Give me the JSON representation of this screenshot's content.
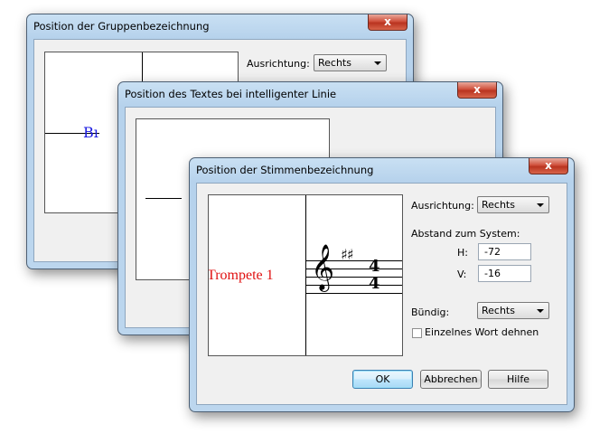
{
  "dialog_back": {
    "title": "Position der Gruppenbezeichnung",
    "close_label": "x",
    "orientation_label": "Ausrichtung:",
    "orientation_value": "Rechts",
    "preview_text": "Bı"
  },
  "dialog_middle": {
    "title": "Position des Textes bei intelligenter Linie",
    "close_label": "x"
  },
  "dialog_front": {
    "title": "Position der Stimmenbezeichnung",
    "close_label": "x",
    "preview_text": "Trompete 1",
    "orientation_label": "Ausrichtung:",
    "orientation_value": "Rechts",
    "distance_label": "Abstand zum System:",
    "h_label": "H:",
    "h_value": "-72",
    "v_label": "V:",
    "v_value": "-16",
    "align_label": "Bündig:",
    "align_value": "Rechts",
    "stretch_label": "Einzelnes Wort dehnen",
    "stretch_checked": false,
    "ok_label": "OK",
    "cancel_label": "Abbrechen",
    "help_label": "Hilfe"
  },
  "music": {
    "clef": "𝄞",
    "key_signature": "♯♯",
    "time_top": "4",
    "time_bottom": "4"
  },
  "colors": {
    "label_red": "#e01010",
    "label_blue": "#1a1ae0"
  }
}
